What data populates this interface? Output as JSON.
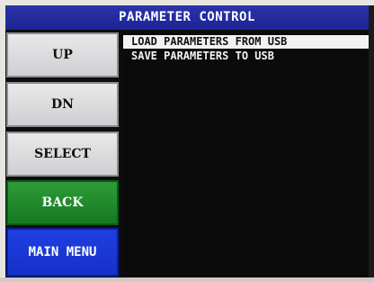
{
  "header": {
    "title": "PARAMETER CONTROL"
  },
  "buttons": {
    "up": "UP",
    "dn": "DN",
    "select": "SELECT",
    "back": "BACK",
    "main_menu": "MAIN MENU"
  },
  "list": {
    "items": [
      {
        "label": "LOAD PARAMETERS FROM USB",
        "selected": true
      },
      {
        "label": "SAVE PARAMETERS TO USB",
        "selected": false
      }
    ]
  },
  "colors": {
    "title_bar": "#1c2496",
    "back_button": "#157a22",
    "main_menu_button": "#1531c9",
    "screen_bg": "#0d0d0f",
    "selected_row": "#f2f2f2"
  }
}
